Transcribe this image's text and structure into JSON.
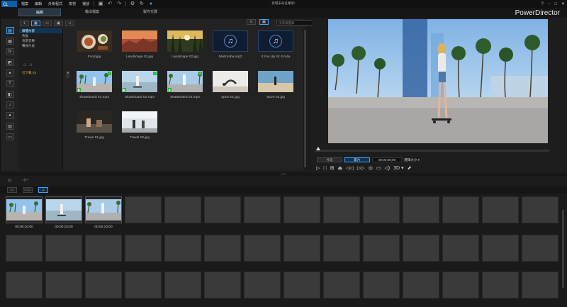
{
  "app": {
    "menu": [
      "檔案",
      "編輯",
      "外掛程式",
      "檢視",
      "播放"
    ],
    "doc_title": "新增未命名專案*",
    "brand": "PowerDirector",
    "window_controls": [
      "?",
      "−",
      "□",
      "✕"
    ]
  },
  "tabs": [
    {
      "label": "編輯",
      "active": true
    },
    {
      "label": "輸出檔案",
      "active": false
    },
    {
      "label": "製作光碟",
      "active": false
    }
  ],
  "library": {
    "search_placeholder": "搜尋媒體庫",
    "tree": [
      {
        "label": "媒體內容",
        "selected": true
      },
      {
        "label": "色板",
        "selected": false
      },
      {
        "label": "背景音樂",
        "selected": false
      },
      {
        "label": "聲效片段",
        "selected": false
      }
    ],
    "download_label": "已下載 (0)",
    "items": [
      {
        "name": "Food.jpg",
        "kind": "food"
      },
      {
        "name": "Landscape 01.jpg",
        "kind": "landscape1"
      },
      {
        "name": "Landscape 02.jpg",
        "kind": "landscape2"
      },
      {
        "name": "Mahoroba.mp3",
        "kind": "music"
      },
      {
        "name": "Il.You Up for It.m4a",
        "kind": "music"
      },
      {
        "name": "Skateboard 01.mp4",
        "kind": "skate1"
      },
      {
        "name": "Skateboard 02.mp4",
        "kind": "skate2"
      },
      {
        "name": "Skateboard 03.mp4",
        "kind": "skate3"
      },
      {
        "name": "Sport 01.jpg",
        "kind": "sport1"
      },
      {
        "name": "Sport 02.jpg",
        "kind": "sport2"
      },
      {
        "name": "Travel 01.jpg",
        "kind": "travel1"
      },
      {
        "name": "Travel 02.jpg",
        "kind": "travel2"
      }
    ]
  },
  "preview": {
    "mode_clip": "片段",
    "mode_movie": "影片",
    "timecode": "00;00;00;00",
    "aspect": "選擇大小 ▾",
    "controls": [
      "▷",
      "□",
      "⊞",
      "⏏",
      "◁◁",
      "▷▷",
      "◎",
      "▭",
      "◁)",
      "3D ▾",
      "⬈"
    ]
  },
  "storyboard": {
    "tabs": [
      "▭",
      "▭▭",
      "♫"
    ],
    "clips": [
      {
        "kind": "skate1",
        "duration": "00;00;10;00"
      },
      {
        "kind": "skate2",
        "duration": "00;00;10;00"
      },
      {
        "kind": "skate3",
        "duration": "00;00;10;00"
      }
    ]
  }
}
